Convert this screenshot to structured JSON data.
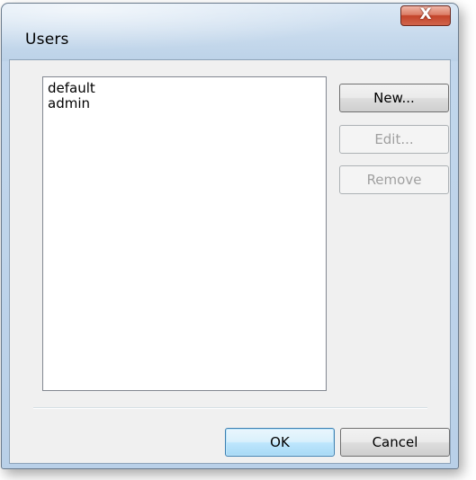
{
  "window": {
    "title": "Users",
    "close_label": "X"
  },
  "users": {
    "items": [
      "default",
      "admin"
    ]
  },
  "buttons": {
    "new_label": "New...",
    "edit_label": "Edit...",
    "remove_label": "Remove",
    "ok_label": "OK",
    "cancel_label": "Cancel"
  },
  "colors": {
    "titlebar": "#c6d9ec",
    "client_bg": "#f0f0f0",
    "close_button": "#c4442a",
    "default_button": "#bee6fd",
    "disabled_text": "#a0a0a0"
  }
}
